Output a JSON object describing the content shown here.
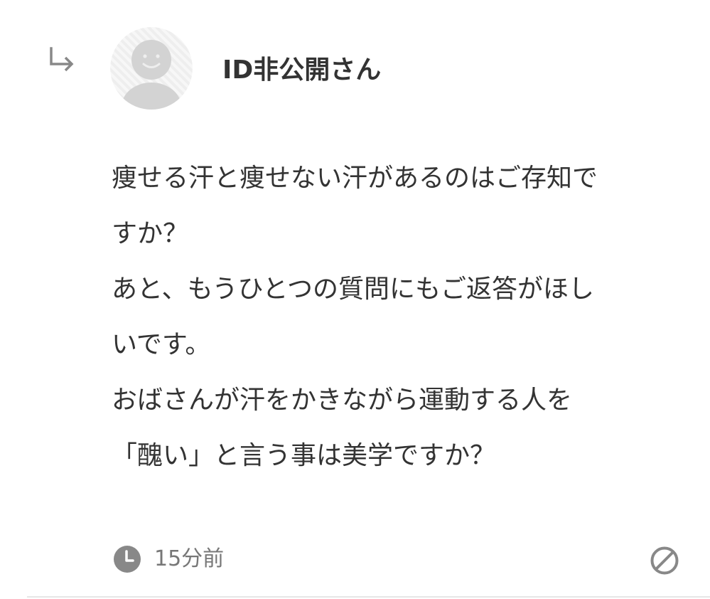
{
  "comment": {
    "reply_icon": "reply-arrow-icon",
    "avatar_icon": "default-avatar-icon",
    "username": "ID非公開さん",
    "body_lines": [
      "痩せる汗と痩せない汗があるのはご存知で",
      "すか？",
      "あと、もうひとつの質問にもご返答がほし",
      "いです。",
      "おばさんが汗をかきながら運動する人を",
      "「醜い」と言う事は美学ですか？"
    ],
    "timestamp": "15分前",
    "time_icon": "clock-icon",
    "report_icon": "report-prohibited-icon"
  },
  "colors": {
    "text": "#333333",
    "meta_text": "#777777",
    "icon_gray": "#888888",
    "avatar_bg": "#eeeeee",
    "avatar_figure": "#d3d3d3",
    "divider": "#e6e6e6"
  }
}
